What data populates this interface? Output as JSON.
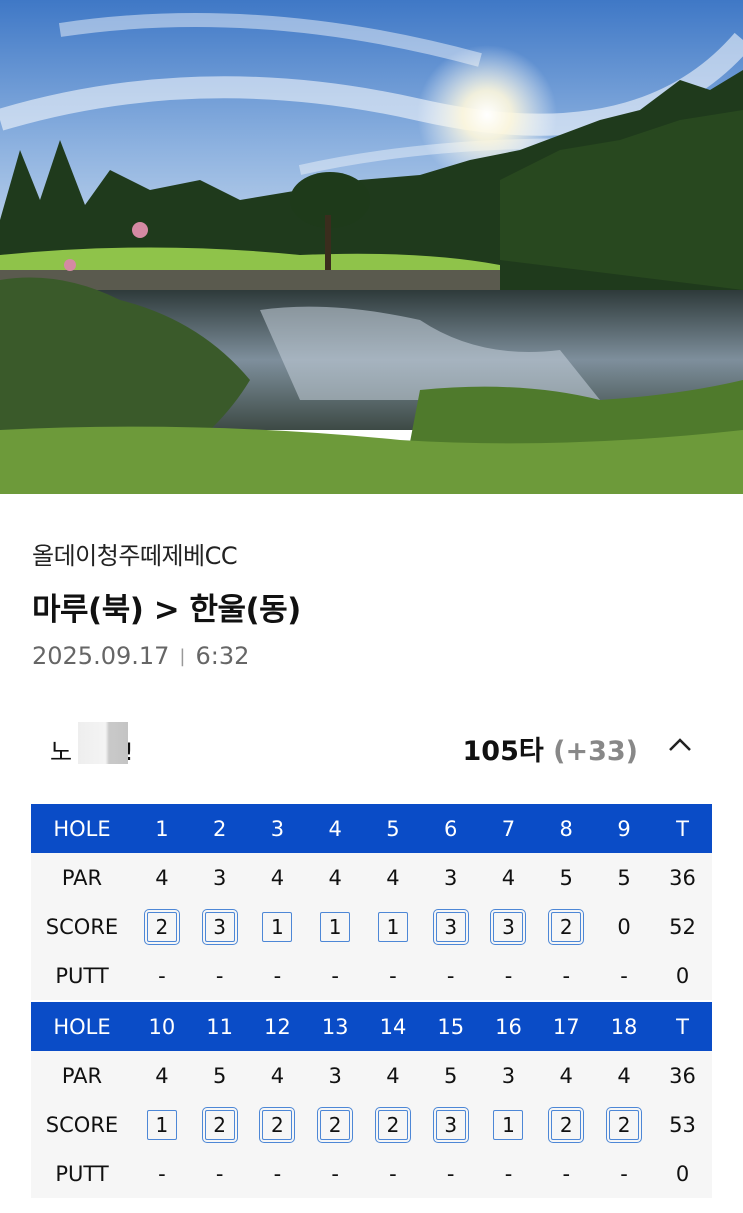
{
  "course": {
    "name": "올데이청주떼제베CC",
    "route": "마루(북) > 한울(동)",
    "date": "2025.09.17",
    "time": "6:32"
  },
  "player": {
    "name_visible": "노",
    "name_suffix": "!",
    "total_strokes": "105타",
    "over_par": "(+33)"
  },
  "icons": {
    "collapse": "chevron-up-icon"
  },
  "colors": {
    "header_bg": "#0a4cc7",
    "score_box": "#4d87d6"
  },
  "scorecard": {
    "labels": {
      "hole": "HOLE",
      "par": "PAR",
      "score": "SCORE",
      "putt": "PUTT",
      "total": "T"
    },
    "front": {
      "holes": [
        "1",
        "2",
        "3",
        "4",
        "5",
        "6",
        "7",
        "8",
        "9"
      ],
      "par": [
        "4",
        "3",
        "4",
        "4",
        "4",
        "3",
        "4",
        "5",
        "5"
      ],
      "par_total": "36",
      "score": [
        "2",
        "3",
        "1",
        "1",
        "1",
        "3",
        "3",
        "2",
        "0"
      ],
      "score_total": "52",
      "score_box": [
        "double",
        "double",
        "single",
        "single",
        "single",
        "double",
        "double",
        "double",
        "none"
      ],
      "putt": [
        "-",
        "-",
        "-",
        "-",
        "-",
        "-",
        "-",
        "-",
        "-"
      ],
      "putt_total": "0"
    },
    "back": {
      "holes": [
        "10",
        "11",
        "12",
        "13",
        "14",
        "15",
        "16",
        "17",
        "18"
      ],
      "par": [
        "4",
        "5",
        "4",
        "3",
        "4",
        "5",
        "3",
        "4",
        "4"
      ],
      "par_total": "36",
      "score": [
        "1",
        "2",
        "2",
        "2",
        "2",
        "3",
        "1",
        "2",
        "2"
      ],
      "score_total": "53",
      "score_box": [
        "single",
        "double",
        "double",
        "double",
        "double",
        "double",
        "single",
        "double",
        "double"
      ],
      "putt": [
        "-",
        "-",
        "-",
        "-",
        "-",
        "-",
        "-",
        "-",
        "-"
      ],
      "putt_total": "0"
    }
  }
}
